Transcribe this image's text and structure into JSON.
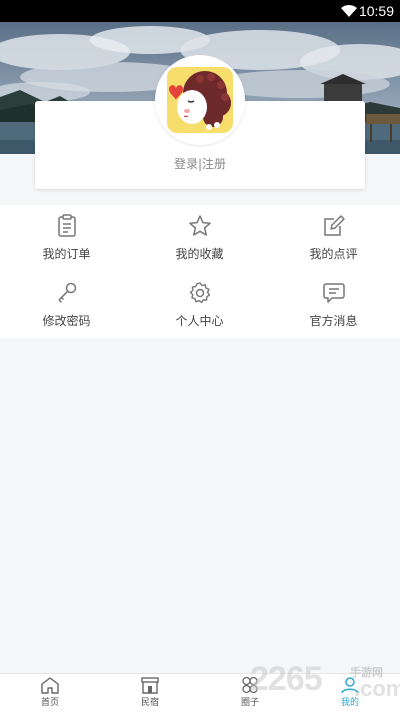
{
  "status_bar": {
    "time": "10:59",
    "wifi_icon": "wifi-icon"
  },
  "profile": {
    "login_text": "登录|注册",
    "avatar_icon": "girl-avatar"
  },
  "menu": {
    "items": [
      {
        "label": "我的订单",
        "icon": "clipboard-icon"
      },
      {
        "label": "我的收藏",
        "icon": "star-icon"
      },
      {
        "label": "我的点评",
        "icon": "edit-icon"
      },
      {
        "label": "修改密码",
        "icon": "key-icon"
      },
      {
        "label": "个人中心",
        "icon": "gear-icon"
      },
      {
        "label": "官方消息",
        "icon": "message-icon"
      }
    ]
  },
  "tabbar": {
    "tabs": [
      {
        "label": "首页",
        "icon": "home-icon"
      },
      {
        "label": "民宿",
        "icon": "shop-icon"
      },
      {
        "label": "圈子",
        "icon": "circles-icon"
      },
      {
        "label": "我的",
        "icon": "user-icon",
        "active": true
      }
    ],
    "active_color": "#2ea7d6"
  },
  "watermark": {
    "main": "2265",
    "sub": "手游网",
    "domain": ".com"
  }
}
